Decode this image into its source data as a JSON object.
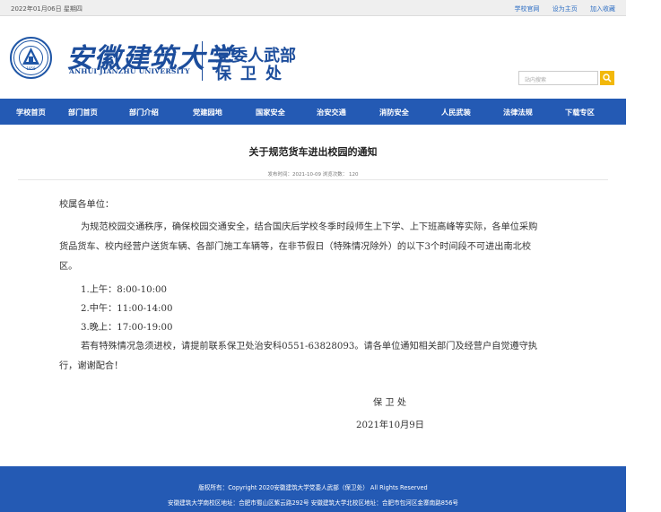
{
  "topbar": {
    "date": "2022年01月06日 星期四",
    "links": [
      "学校官网",
      "设为主页",
      "加入收藏"
    ]
  },
  "header": {
    "university_cn": "安徽建筑大学",
    "university_en": "ANHUI JIANZHU UNIVERSITY",
    "seal_year": "1958",
    "dept_line1": "党委人武部",
    "dept_line2": "保卫处",
    "search_placeholder": "站内搜索"
  },
  "nav": [
    "学校首页",
    "部门首页",
    "部门介绍",
    "党建园地",
    "国家安全",
    "治安交通",
    "消防安全",
    "人民武装",
    "法律法规",
    "下载专区"
  ],
  "article": {
    "title": "关于规范货车进出校园的通知",
    "meta": "发布时间：2021-10-09  浏览次数：  120",
    "salutation": "校属各单位：",
    "para1_lines": [
      "为规范校园交通秩序，确保校园交通安全，结合国庆后学校冬季时段师生上下学、上下班高峰等实际，各单位采购",
      "货品货车、校内经营户送货车辆、各部门施工车辆等，在非节假日（特殊情况除外）的以下3个时间段不可进出南北校",
      "区。"
    ],
    "times": [
      "1.上午：8:00-10:00",
      "2.中午：11:00-14:00",
      "3.晚上：17:00-19:00"
    ],
    "para2_lines": [
      "若有特殊情况急须进校，请提前联系保卫处治安科0551-63828093。请各单位通知相关部门及经营户自觉遵守执",
      "行，谢谢配合！"
    ],
    "signature": "保 卫 处",
    "date": "2021年10月9日"
  },
  "footer": {
    "copyright": "版权所有：Copyright 2020安徽建筑大学党委人武部（保卫处） All Rights Reserved",
    "address": "安徽建筑大学南校区地址：合肥市蜀山区紫云路292号 安徽建筑大学北校区地址：合肥市包河区金寨南路856号"
  },
  "colors": {
    "nav": "#245ab4",
    "brand": "#1c4d9c",
    "search_button": "#f2b80b"
  }
}
